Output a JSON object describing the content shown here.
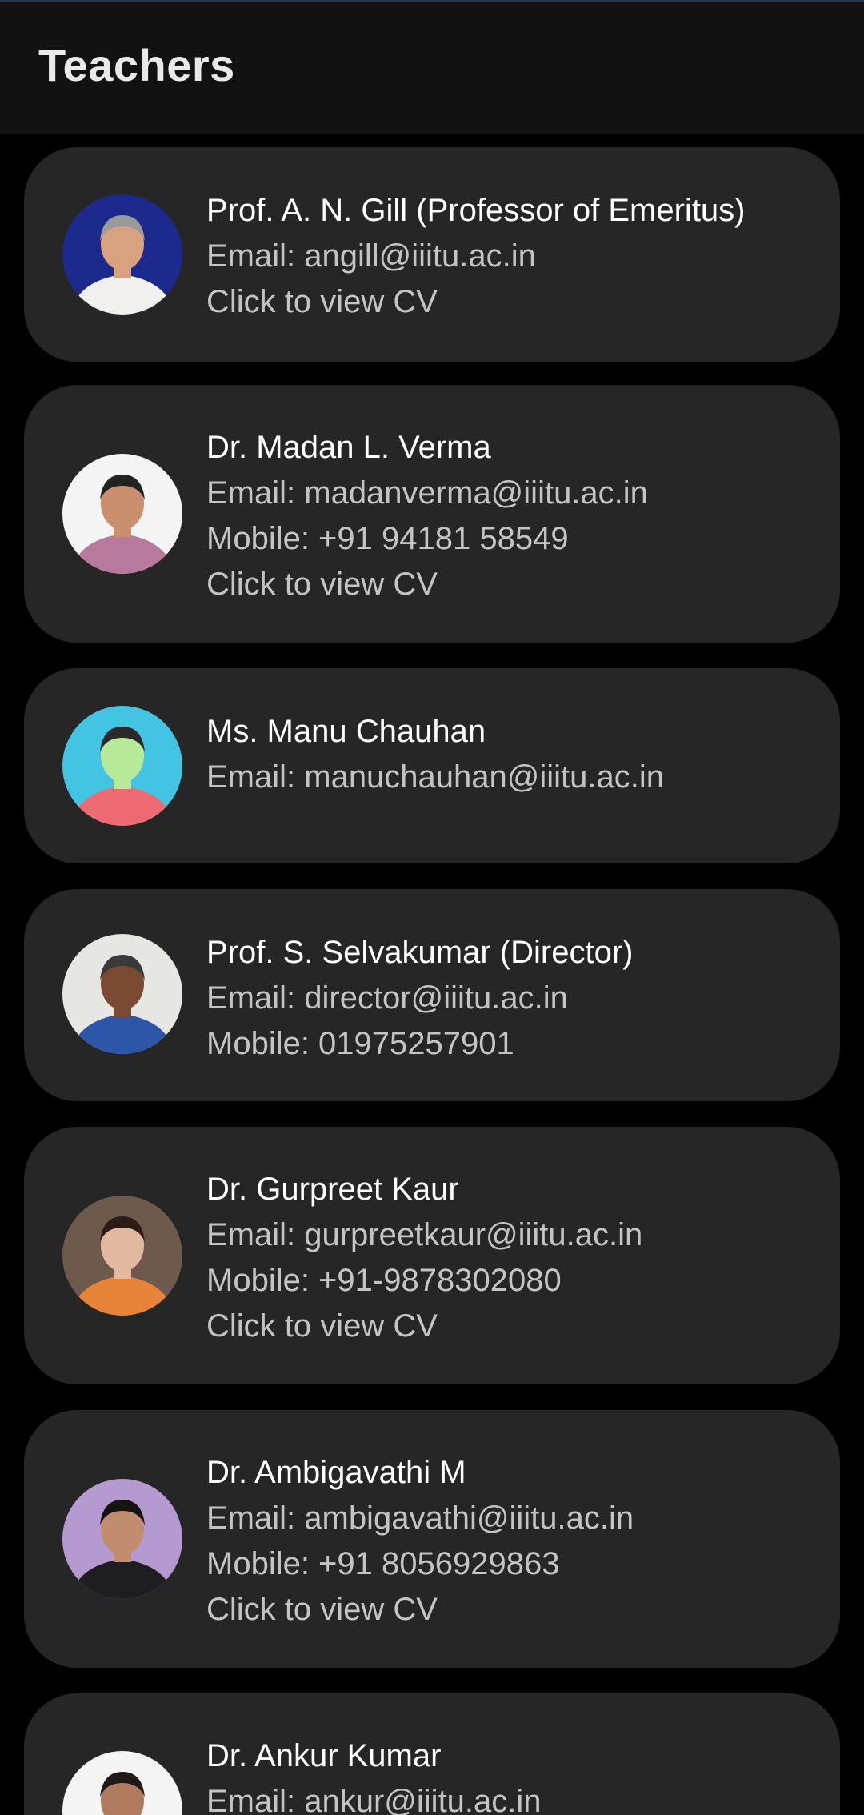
{
  "appbar": {
    "title": "Teachers"
  },
  "teachers": [
    {
      "name": "Prof. A. N. Gill (Professor of Emeritus)",
      "email": "Email: angill@iiitu.ac.in",
      "cv": "Click to view CV",
      "avatar_bg": "#1b2a8c",
      "avatar_shirt": "#f2f0ee",
      "avatar_skin": "#d8a17f",
      "avatar_hair": "#9a9a9a"
    },
    {
      "name": "Dr. Madan L. Verma",
      "email": "Email: madanverma@iiitu.ac.in",
      "mobile": "Mobile: +91 94181 58549",
      "cv": "Click to view CV",
      "avatar_bg": "#f4f4f4",
      "avatar_shirt": "#b87a9c",
      "avatar_skin": "#c98f6e",
      "avatar_hair": "#222222"
    },
    {
      "name": "Ms. Manu Chauhan",
      "email": "Email: manuchauhan@iiitu.ac.in",
      "avatar_bg": "#43c4e3",
      "avatar_shirt": "#ee6a72",
      "avatar_skin": "#b7ea98",
      "avatar_hair": "#2a2a2a"
    },
    {
      "name": "Prof. S. Selvakumar (Director)",
      "email": "Email: director@iiitu.ac.in",
      "mobile": "Mobile: 01975257901",
      "avatar_bg": "#e6e6e2",
      "avatar_shirt": "#2d55a8",
      "avatar_skin": "#7a4a33",
      "avatar_hair": "#3a3a3a"
    },
    {
      "name": "Dr. Gurpreet Kaur",
      "email": "Email: gurpreetkaur@iiitu.ac.in",
      "mobile": "Mobile: +91-9878302080",
      "cv": "Click to view CV",
      "avatar_bg": "#6e5a4c",
      "avatar_shirt": "#e8843a",
      "avatar_skin": "#e3b8a1",
      "avatar_hair": "#2b1d16"
    },
    {
      "name": "Dr. Ambigavathi M",
      "email": "Email: ambigavathi@iiitu.ac.in",
      "mobile": "Mobile: +91 8056929863",
      "cv": "Click to view CV",
      "avatar_bg": "#b59ad1",
      "avatar_shirt": "#1e1e22",
      "avatar_skin": "#c28c6e",
      "avatar_hair": "#161313"
    },
    {
      "name": "Dr. Ankur Kumar",
      "email": "Email: ankur@iiitu.ac.in",
      "avatar_bg": "#f4f4f4",
      "avatar_shirt": "#6b6b6b",
      "avatar_skin": "#b07a5e",
      "avatar_hair": "#1f1a17"
    }
  ]
}
